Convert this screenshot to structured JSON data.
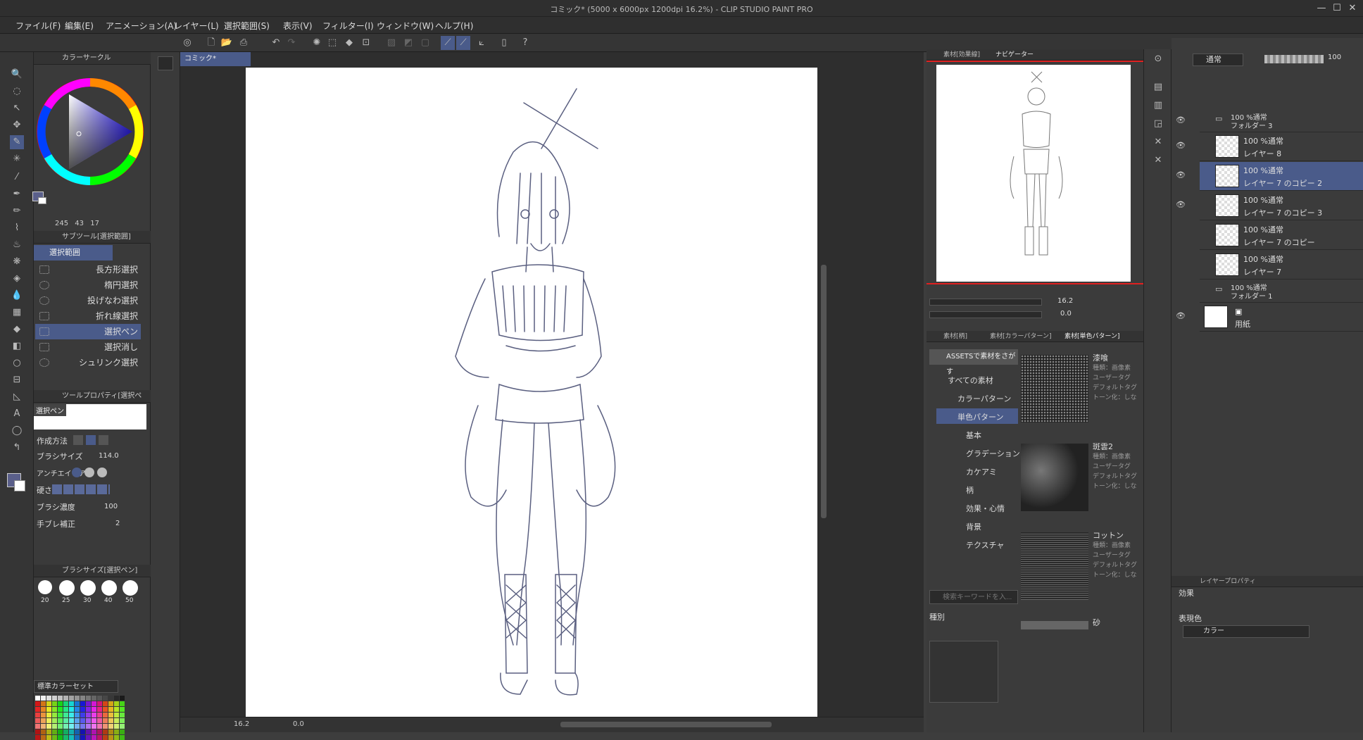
{
  "app": {
    "title": "コミック* (5000 x 6000px 1200dpi 16.2%) - CLIP STUDIO PAINT PRO",
    "window_controls": [
      "—",
      "☐",
      "✕"
    ]
  },
  "menu": [
    "ファイル(F)",
    "編集(E)",
    "アニメーション(A)",
    "レイヤー(L)",
    "選択範囲(S)",
    "表示(V)",
    "フィルター(I)",
    "ウィンドウ(W)",
    "ヘルプ(H)"
  ],
  "color_circle": {
    "header": "カラーサークル",
    "values": [
      "245",
      "43",
      "17"
    ],
    "main_color": "#5a5f8a",
    "sub_color": "#ffffff"
  },
  "sub_tool": {
    "header": "サブツール[選択範囲]",
    "group": "選択範囲",
    "items": [
      "長方形選択",
      "楕円選択",
      "投げなわ選択",
      "折れ線選択",
      "選択ペン",
      "選択消し",
      "シュリンク選択"
    ]
  },
  "tool_property": {
    "header": "ツールプロパティ[選択ペン]",
    "tool_name": "選択ペン",
    "rows": [
      {
        "label": "作成方法",
        "value": ""
      },
      {
        "label": "ブラシサイズ",
        "value": "114.0"
      },
      {
        "label": "アンチエイリアス",
        "value": ""
      },
      {
        "label": "硬さ",
        "value": ""
      },
      {
        "label": "ブラシ濃度",
        "value": "100"
      },
      {
        "label": "手ブレ補正",
        "value": "2"
      }
    ]
  },
  "brush_size": {
    "header": "ブラシサイズ[選択ペン]",
    "sizes": [
      "20",
      "25",
      "30",
      "40",
      "50"
    ]
  },
  "color_set": {
    "selected": "標準カラーセット"
  },
  "canvas": {
    "tab": "コミック*",
    "zoom": "16.2",
    "rotation": "0.0"
  },
  "navigator": {
    "tabs": [
      "素材[効果線]",
      "ナビゲーター"
    ],
    "zoom": "16.2",
    "angle": "0.0"
  },
  "materials": {
    "tabs": [
      "素材[柄]",
      "素材[カラーパターン]",
      "素材[単色パターン]"
    ],
    "assets_button": "ASSETSで素材をさがす",
    "tree": [
      "すべての素材",
      "カラーパターン",
      "単色パターン",
      "基本",
      "グラデーション",
      "カケアミ",
      "柄",
      "効果・心情",
      "背景",
      "テクスチャ"
    ],
    "items": [
      {
        "name": "漆喰",
        "meta": [
          "種類：画像素",
          "ユーザータグ",
          "デフォルトタグ",
          "トーン化：しな"
        ]
      },
      {
        "name": "斑雲2",
        "meta": [
          "種類：画像素",
          "ユーザータグ",
          "デフォルトタグ",
          "トーン化：しな"
        ]
      },
      {
        "name": "コットン",
        "meta": [
          "種類：画像素",
          "ユーザータグ",
          "デフォルトタグ",
          "トーン化：しな"
        ]
      },
      {
        "name": "砂",
        "meta": []
      }
    ],
    "search_placeholder": "検索キーワードを入...",
    "kind_label": "種別"
  },
  "layers": {
    "blend_mode": "通常",
    "opacity": "100",
    "list": [
      {
        "mode": "100 %通常",
        "name": "フォルダー 3",
        "type": "folder",
        "selected": false
      },
      {
        "mode": "100 %通常",
        "name": "レイヤー 8",
        "type": "raster",
        "selected": false
      },
      {
        "mode": "100 %通常",
        "name": "レイヤー 7 のコピー 2",
        "type": "raster",
        "selected": true
      },
      {
        "mode": "100 %通常",
        "name": "レイヤー 7 のコピー 3",
        "type": "raster",
        "selected": false
      },
      {
        "mode": "100 %通常",
        "name": "レイヤー 7 のコピー",
        "type": "raster",
        "selected": false
      },
      {
        "mode": "100 %通常",
        "name": "レイヤー 7",
        "type": "raster",
        "selected": false
      },
      {
        "mode": "100 %通常",
        "name": "フォルダー 1",
        "type": "folder",
        "selected": false
      },
      {
        "mode": "",
        "name": "用紙",
        "type": "paper",
        "selected": false
      }
    ]
  },
  "layer_property": {
    "header": "レイヤープロパティ",
    "effect_label": "効果",
    "expression_label": "表現色",
    "expression_value": "カラー"
  }
}
